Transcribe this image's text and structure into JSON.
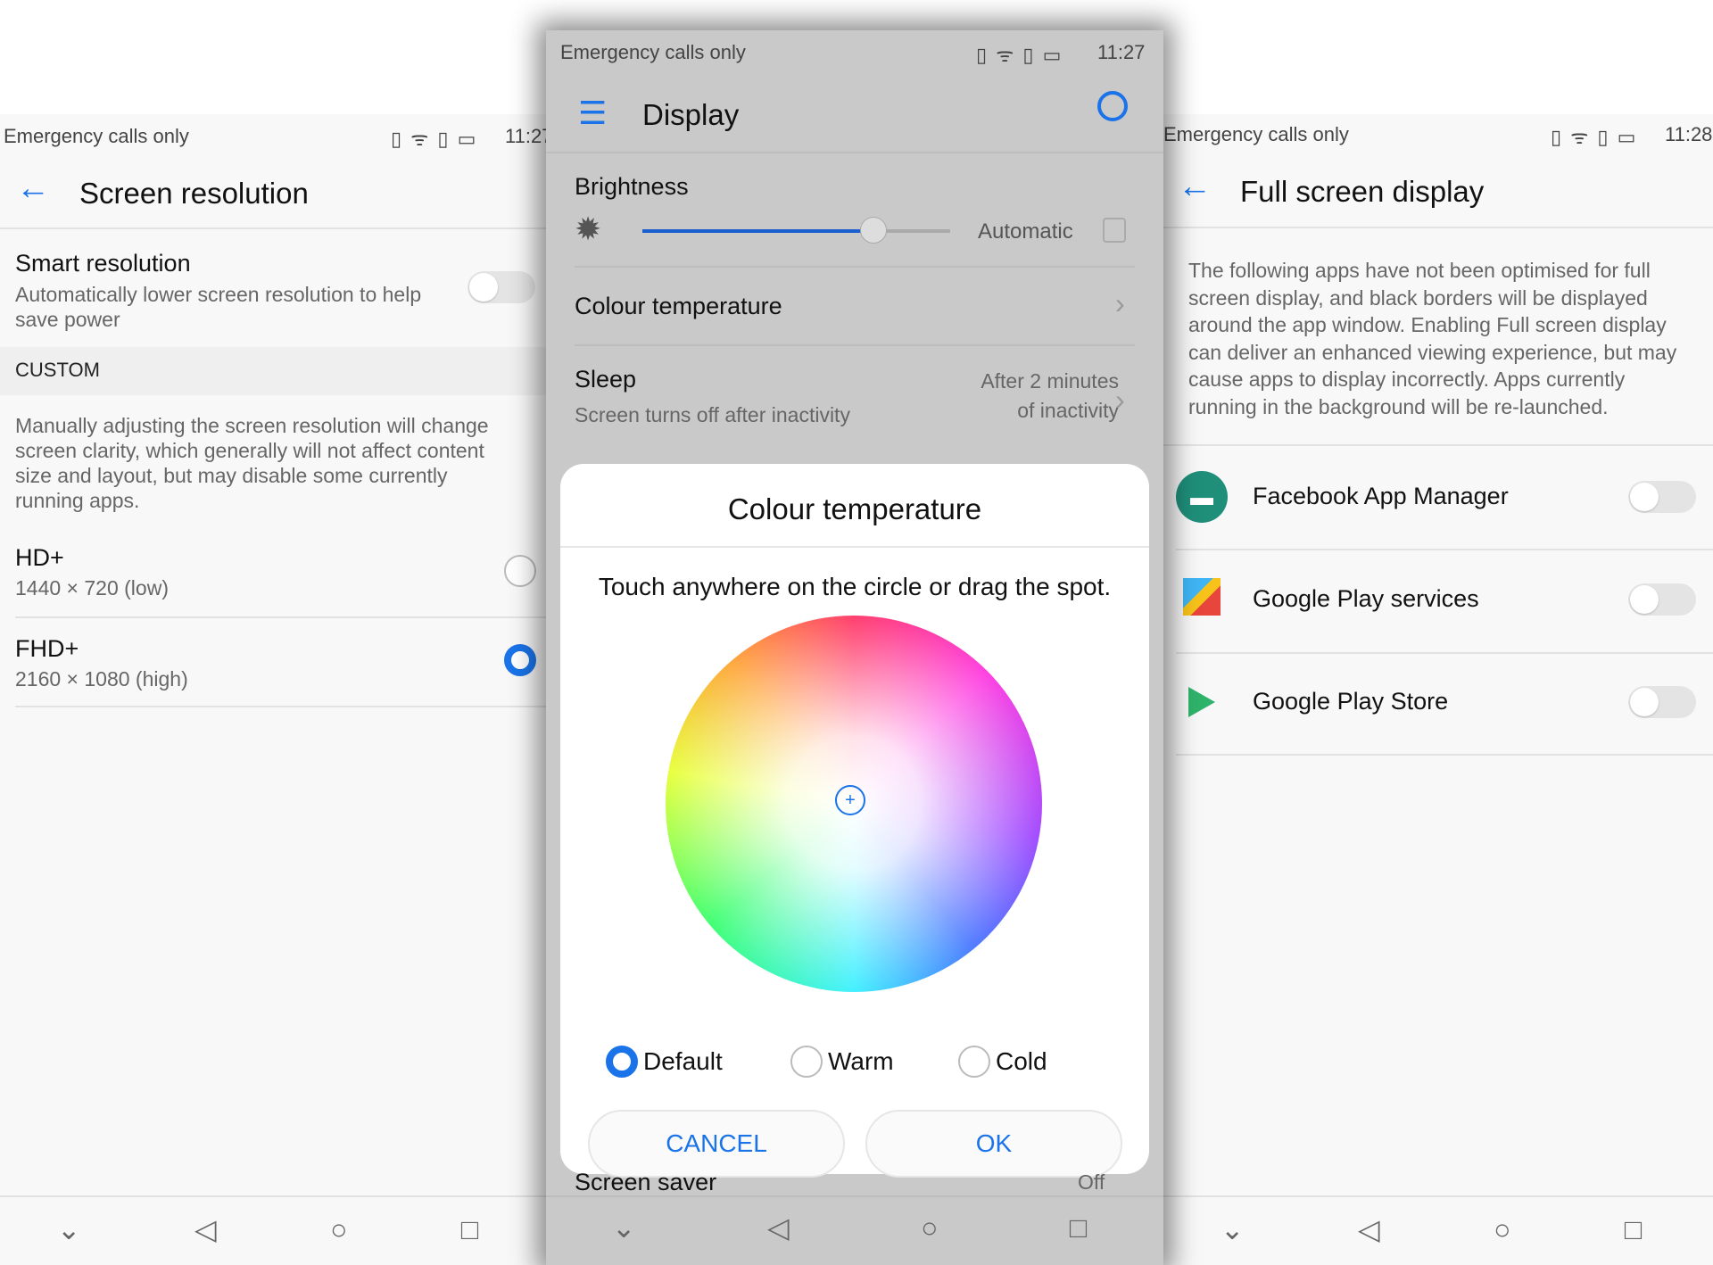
{
  "left": {
    "status": {
      "carrier": "Emergency calls only",
      "time": "11:27"
    },
    "title": "Screen resolution",
    "smart": {
      "label": "Smart resolution",
      "desc": "Automatically lower screen resolution to help save power",
      "enabled": false
    },
    "section": "CUSTOM",
    "note": "Manually adjusting the screen resolution will change screen clarity, which generally will not affect content size and layout, but may disable some currently running apps.",
    "options": [
      {
        "label": "HD+",
        "detail": "1440 × 720 (low)",
        "selected": false
      },
      {
        "label": "FHD+",
        "detail": "2160 × 1080 (high)",
        "selected": true
      }
    ]
  },
  "mid": {
    "status": {
      "carrier": "Emergency calls only",
      "time": "11:27"
    },
    "title": "Display",
    "brightness": {
      "label": "Brightness",
      "level": 0.75,
      "auto_label": "Automatic",
      "auto": false
    },
    "colour_temp": "Colour temperature",
    "sleep": {
      "label": "Sleep",
      "desc": "Screen turns off after inactivity",
      "value_line1": "After 2 minutes",
      "value_line2": "of inactivity"
    },
    "screensaver": {
      "label": "Screen saver",
      "value": "Off"
    },
    "dialog": {
      "title": "Colour temperature",
      "hint": "Touch anywhere on the circle or drag the spot.",
      "options": [
        {
          "label": "Default",
          "selected": true
        },
        {
          "label": "Warm",
          "selected": false
        },
        {
          "label": "Cold",
          "selected": false
        }
      ],
      "cancel": "CANCEL",
      "ok": "OK"
    }
  },
  "right": {
    "status": {
      "carrier": "Emergency calls only",
      "time": "11:28"
    },
    "title": "Full screen display",
    "desc": "The following apps have not been optimised for full screen display, and black borders will be displayed around the app window. Enabling Full screen display can deliver an enhanced viewing experience, but may cause apps to display incorrectly. Apps currently running in the background will be re-launched.",
    "apps": [
      {
        "name": "Facebook App Manager",
        "enabled": false
      },
      {
        "name": "Google Play services",
        "enabled": false
      },
      {
        "name": "Google Play Store",
        "enabled": false
      }
    ]
  },
  "accent": "#1a73e8"
}
